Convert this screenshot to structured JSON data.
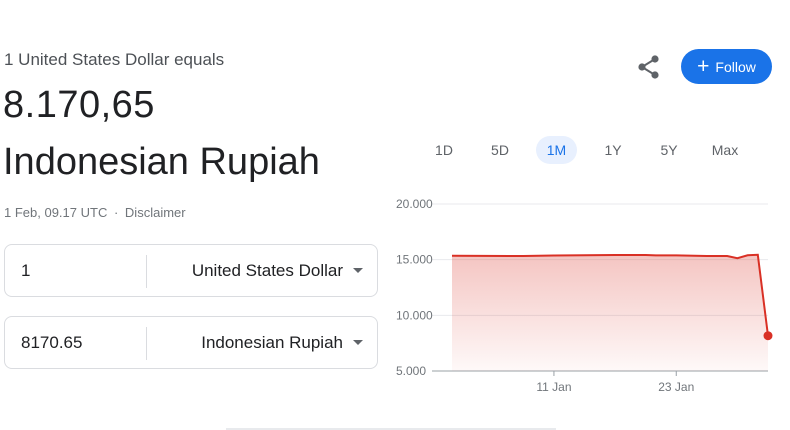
{
  "header": {
    "equals_text": "1 United States Dollar equals",
    "rate_text": "8.170,65",
    "target_currency_name": "Indonesian Rupiah",
    "timestamp": "1 Feb, 09.17 UTC",
    "separator": "·",
    "disclaimer": "Disclaimer"
  },
  "actions": {
    "share_icon": "share-icon",
    "follow_label": "Follow",
    "follow_icon_glyph": "+",
    "accent": "#1a73e8"
  },
  "converter": {
    "row1": {
      "amount": "1",
      "currency": "United States Dollar"
    },
    "row2": {
      "amount": "8170.65",
      "currency": "Indonesian Rupiah"
    }
  },
  "range_tabs": {
    "items": [
      "1D",
      "5D",
      "1M",
      "1Y",
      "5Y",
      "Max"
    ],
    "selected": "1M"
  },
  "chart_data": {
    "type": "area",
    "line_color": "#d93025",
    "y_ticks": [
      "20.000",
      "15.000",
      "10.000",
      "5.000"
    ],
    "ylim": [
      5000,
      20000
    ],
    "x_ticks": [
      "11 Jan",
      "23 Jan"
    ],
    "grid": true,
    "series": [
      {
        "x": [
          "1 Jan",
          "4 Jan",
          "8 Jan",
          "11 Jan",
          "14 Jan",
          "17 Jan",
          "20 Jan",
          "21 Jan",
          "23 Jan",
          "26 Jan",
          "28 Jan",
          "29 Jan",
          "30 Jan",
          "31 Jan",
          "1 Feb"
        ],
        "values": [
          15350,
          15340,
          15330,
          15370,
          15390,
          15420,
          15420,
          15380,
          15380,
          15330,
          15330,
          15130,
          15390,
          15440,
          8170.65
        ]
      }
    ]
  }
}
